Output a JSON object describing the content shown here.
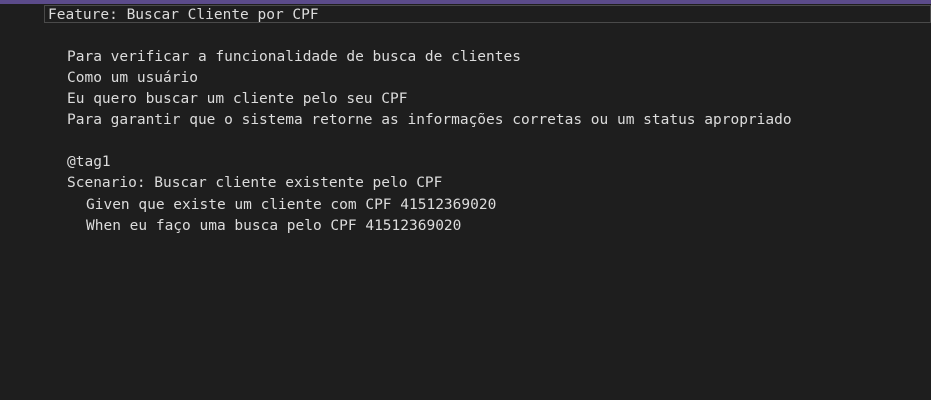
{
  "editor": {
    "accent_color": "#5b4b8a",
    "background_color": "#1e1e1e",
    "text_color": "#dcdcdc",
    "lines": [
      "Feature: Buscar Cliente por CPF",
      "Para verificar a funcionalidade de busca de clientes",
      "Como um usuário",
      "Eu quero buscar um cliente pelo seu CPF",
      "Para garantir que o sistema retorne as informações corretas ou um status apropriado",
      "@tag1",
      "Scenario: Buscar cliente existente pelo CPF",
      "Given que existe um cliente com CPF 41512369020",
      "When eu faço uma busca pelo CPF 41512369020"
    ]
  }
}
